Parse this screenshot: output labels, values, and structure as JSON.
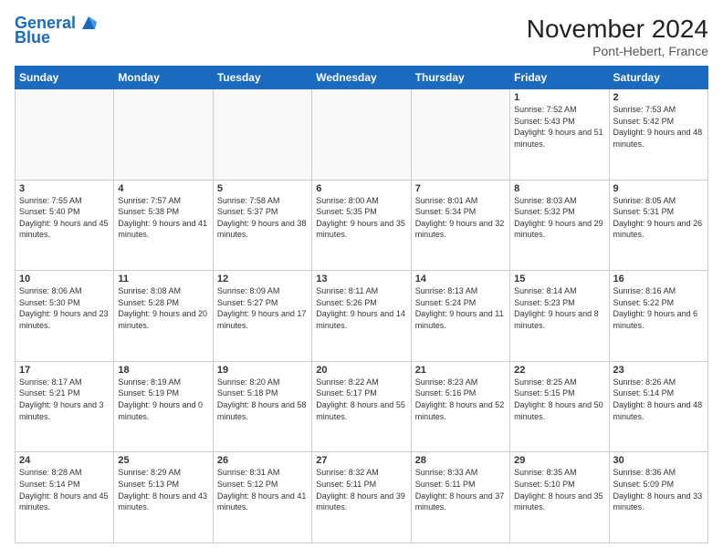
{
  "header": {
    "logo_line1": "General",
    "logo_line2": "Blue",
    "month_title": "November 2024",
    "location": "Pont-Hebert, France"
  },
  "days_of_week": [
    "Sunday",
    "Monday",
    "Tuesday",
    "Wednesday",
    "Thursday",
    "Friday",
    "Saturday"
  ],
  "weeks": [
    [
      {
        "day": "",
        "info": ""
      },
      {
        "day": "",
        "info": ""
      },
      {
        "day": "",
        "info": ""
      },
      {
        "day": "",
        "info": ""
      },
      {
        "day": "",
        "info": ""
      },
      {
        "day": "1",
        "info": "Sunrise: 7:52 AM\nSunset: 5:43 PM\nDaylight: 9 hours and 51 minutes."
      },
      {
        "day": "2",
        "info": "Sunrise: 7:53 AM\nSunset: 5:42 PM\nDaylight: 9 hours and 48 minutes."
      }
    ],
    [
      {
        "day": "3",
        "info": "Sunrise: 7:55 AM\nSunset: 5:40 PM\nDaylight: 9 hours and 45 minutes."
      },
      {
        "day": "4",
        "info": "Sunrise: 7:57 AM\nSunset: 5:38 PM\nDaylight: 9 hours and 41 minutes."
      },
      {
        "day": "5",
        "info": "Sunrise: 7:58 AM\nSunset: 5:37 PM\nDaylight: 9 hours and 38 minutes."
      },
      {
        "day": "6",
        "info": "Sunrise: 8:00 AM\nSunset: 5:35 PM\nDaylight: 9 hours and 35 minutes."
      },
      {
        "day": "7",
        "info": "Sunrise: 8:01 AM\nSunset: 5:34 PM\nDaylight: 9 hours and 32 minutes."
      },
      {
        "day": "8",
        "info": "Sunrise: 8:03 AM\nSunset: 5:32 PM\nDaylight: 9 hours and 29 minutes."
      },
      {
        "day": "9",
        "info": "Sunrise: 8:05 AM\nSunset: 5:31 PM\nDaylight: 9 hours and 26 minutes."
      }
    ],
    [
      {
        "day": "10",
        "info": "Sunrise: 8:06 AM\nSunset: 5:30 PM\nDaylight: 9 hours and 23 minutes."
      },
      {
        "day": "11",
        "info": "Sunrise: 8:08 AM\nSunset: 5:28 PM\nDaylight: 9 hours and 20 minutes."
      },
      {
        "day": "12",
        "info": "Sunrise: 8:09 AM\nSunset: 5:27 PM\nDaylight: 9 hours and 17 minutes."
      },
      {
        "day": "13",
        "info": "Sunrise: 8:11 AM\nSunset: 5:26 PM\nDaylight: 9 hours and 14 minutes."
      },
      {
        "day": "14",
        "info": "Sunrise: 8:13 AM\nSunset: 5:24 PM\nDaylight: 9 hours and 11 minutes."
      },
      {
        "day": "15",
        "info": "Sunrise: 8:14 AM\nSunset: 5:23 PM\nDaylight: 9 hours and 8 minutes."
      },
      {
        "day": "16",
        "info": "Sunrise: 8:16 AM\nSunset: 5:22 PM\nDaylight: 9 hours and 6 minutes."
      }
    ],
    [
      {
        "day": "17",
        "info": "Sunrise: 8:17 AM\nSunset: 5:21 PM\nDaylight: 9 hours and 3 minutes."
      },
      {
        "day": "18",
        "info": "Sunrise: 8:19 AM\nSunset: 5:19 PM\nDaylight: 9 hours and 0 minutes."
      },
      {
        "day": "19",
        "info": "Sunrise: 8:20 AM\nSunset: 5:18 PM\nDaylight: 8 hours and 58 minutes."
      },
      {
        "day": "20",
        "info": "Sunrise: 8:22 AM\nSunset: 5:17 PM\nDaylight: 8 hours and 55 minutes."
      },
      {
        "day": "21",
        "info": "Sunrise: 8:23 AM\nSunset: 5:16 PM\nDaylight: 8 hours and 52 minutes."
      },
      {
        "day": "22",
        "info": "Sunrise: 8:25 AM\nSunset: 5:15 PM\nDaylight: 8 hours and 50 minutes."
      },
      {
        "day": "23",
        "info": "Sunrise: 8:26 AM\nSunset: 5:14 PM\nDaylight: 8 hours and 48 minutes."
      }
    ],
    [
      {
        "day": "24",
        "info": "Sunrise: 8:28 AM\nSunset: 5:14 PM\nDaylight: 8 hours and 45 minutes."
      },
      {
        "day": "25",
        "info": "Sunrise: 8:29 AM\nSunset: 5:13 PM\nDaylight: 8 hours and 43 minutes."
      },
      {
        "day": "26",
        "info": "Sunrise: 8:31 AM\nSunset: 5:12 PM\nDaylight: 8 hours and 41 minutes."
      },
      {
        "day": "27",
        "info": "Sunrise: 8:32 AM\nSunset: 5:11 PM\nDaylight: 8 hours and 39 minutes."
      },
      {
        "day": "28",
        "info": "Sunrise: 8:33 AM\nSunset: 5:11 PM\nDaylight: 8 hours and 37 minutes."
      },
      {
        "day": "29",
        "info": "Sunrise: 8:35 AM\nSunset: 5:10 PM\nDaylight: 8 hours and 35 minutes."
      },
      {
        "day": "30",
        "info": "Sunrise: 8:36 AM\nSunset: 5:09 PM\nDaylight: 8 hours and 33 minutes."
      }
    ]
  ]
}
